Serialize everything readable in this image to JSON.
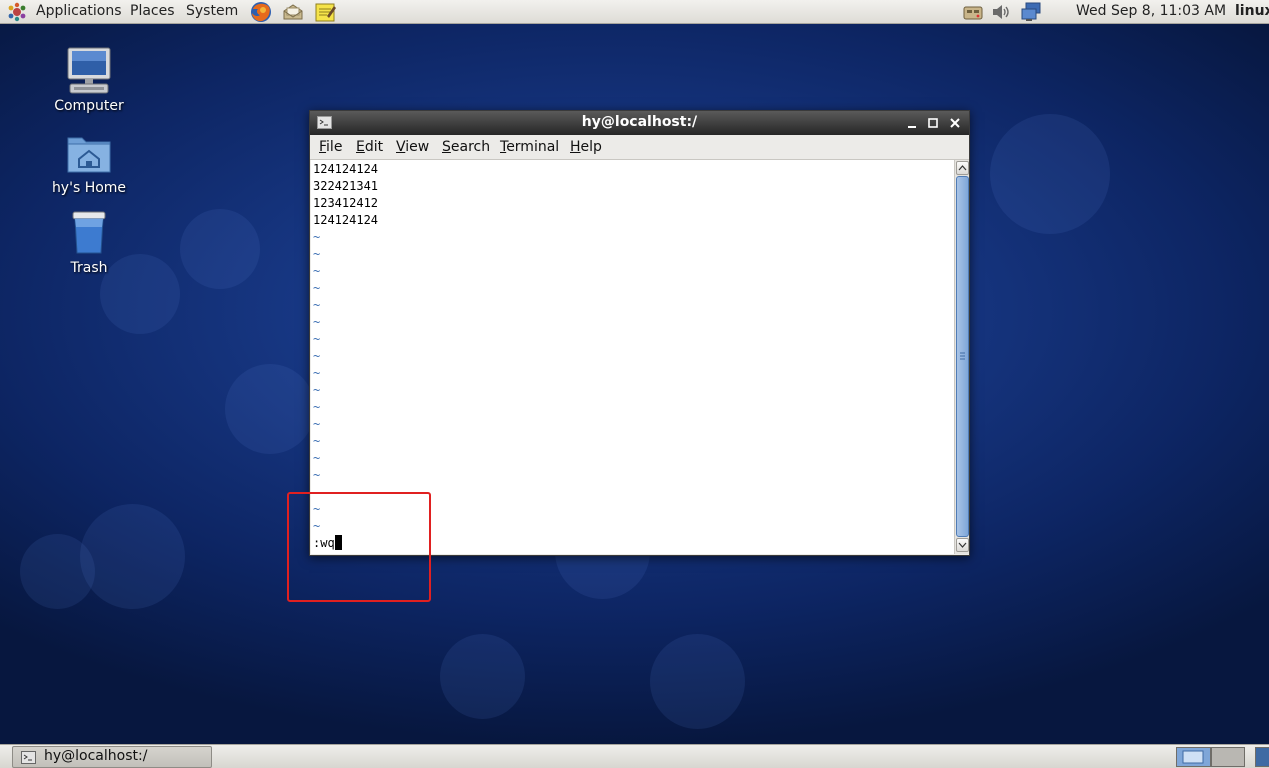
{
  "top_panel": {
    "menus": [
      "Applications",
      "Places",
      "System"
    ],
    "launchers": [
      "firefox-icon",
      "mail-icon",
      "notes-icon"
    ],
    "tray_icons": [
      "network-icon",
      "volume-icon",
      "display-icon"
    ],
    "clock": "Wed Sep  8, 11:03 AM",
    "username": "linux"
  },
  "desktop": {
    "icons": [
      {
        "label": "Computer",
        "icon": "computer-icon"
      },
      {
        "label": "hy's Home",
        "icon": "home-folder-icon"
      },
      {
        "label": "Trash",
        "icon": "trash-icon"
      }
    ]
  },
  "terminal": {
    "title": "hy@localhost:/",
    "menu": [
      {
        "first": "F",
        "rest": "ile"
      },
      {
        "first": "E",
        "rest": "dit"
      },
      {
        "first": "V",
        "rest": "iew"
      },
      {
        "first": "S",
        "rest": "earch"
      },
      {
        "first": "T",
        "rest": "erminal"
      },
      {
        "first": "H",
        "rest": "elp"
      }
    ],
    "lines": [
      "124124124",
      "322421341",
      "123412412",
      "124124124"
    ],
    "tilde": "~",
    "command": ":wq"
  },
  "taskbar": {
    "window_title": "hy@localhost:/"
  },
  "colors": {
    "annotation": "#e02020",
    "tilde": "#3c6fb3",
    "titlebar": "#262626"
  }
}
